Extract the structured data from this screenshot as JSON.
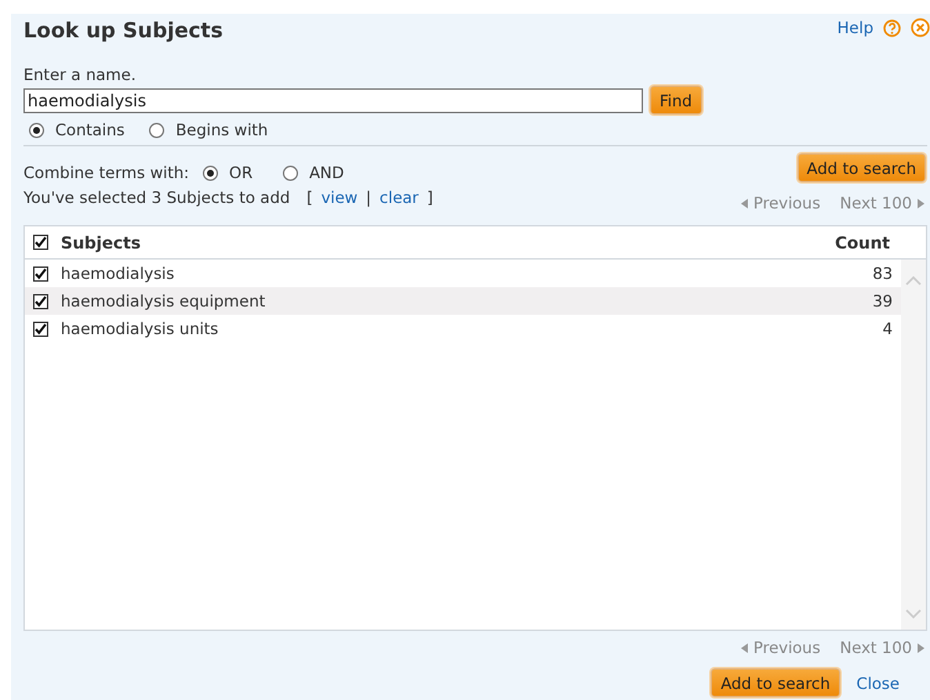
{
  "dialog": {
    "title": "Look up Subjects",
    "help": "Help"
  },
  "name_field": {
    "label": "Enter a name.",
    "value": "haemodialysis",
    "button": "Find"
  },
  "match_options": [
    {
      "label": "Contains",
      "selected": true
    },
    {
      "label": "Begins with",
      "selected": false
    }
  ],
  "combine": {
    "label": "Combine terms with:",
    "options": [
      {
        "label": "OR",
        "selected": true
      },
      {
        "label": "AND",
        "selected": false
      }
    ]
  },
  "add_button_top": "Add to search",
  "selection": {
    "text": "You've selected 3 Subjects to add",
    "open_bracket": "[",
    "view": "view",
    "separator": "|",
    "clear": "clear",
    "close_bracket": "]"
  },
  "pager_top": {
    "previous": "Previous",
    "next": "Next 100"
  },
  "table": {
    "select_all_checked": true,
    "columns": [
      "Subjects",
      "Count"
    ],
    "rows": [
      {
        "subject": "haemodialysis",
        "count": "83",
        "checked": true,
        "highlighted": false
      },
      {
        "subject": "haemodialysis equipment",
        "count": "39",
        "checked": true,
        "highlighted": true
      },
      {
        "subject": "haemodialysis units",
        "count": "4",
        "checked": true,
        "highlighted": false
      }
    ]
  },
  "pager_bottom": {
    "previous": "Previous",
    "next": "Next 100"
  },
  "footer": {
    "add_button": "Add to search",
    "close": "Close"
  }
}
